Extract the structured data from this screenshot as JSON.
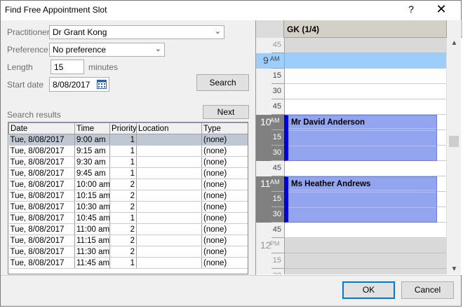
{
  "window": {
    "title": "Find Free Appointment Slot",
    "help": "?",
    "close": "✕"
  },
  "form": {
    "practitioner_label": "Practitioner",
    "practitioner_value": "Dr Grant Kong",
    "preference_label": "Preference",
    "preference_value": "No preference",
    "length_label": "Length",
    "length_value": "15",
    "length_unit": "minutes",
    "startdate_label": "Start date",
    "startdate_value": "8/08/2017",
    "search_button": "Search",
    "results_label": "Search results",
    "next_button": "Next"
  },
  "results": {
    "columns": [
      "Date",
      "Time",
      "Priority",
      "Location",
      "Type"
    ],
    "rows": [
      [
        "Tue, 8/08/2017",
        "9:00 am",
        "1",
        "",
        "(none)"
      ],
      [
        "Tue, 8/08/2017",
        "9:15 am",
        "1",
        "",
        "(none)"
      ],
      [
        "Tue, 8/08/2017",
        "9:30 am",
        "1",
        "",
        "(none)"
      ],
      [
        "Tue, 8/08/2017",
        "9:45 am",
        "1",
        "",
        "(none)"
      ],
      [
        "Tue, 8/08/2017",
        "10:00 am",
        "2",
        "",
        "(none)"
      ],
      [
        "Tue, 8/08/2017",
        "10:15 am",
        "2",
        "",
        "(none)"
      ],
      [
        "Tue, 8/08/2017",
        "10:30 am",
        "2",
        "",
        "(none)"
      ],
      [
        "Tue, 8/08/2017",
        "10:45 am",
        "1",
        "",
        "(none)"
      ],
      [
        "Tue, 8/08/2017",
        "11:00 am",
        "2",
        "",
        "(none)"
      ],
      [
        "Tue, 8/08/2017",
        "11:15 am",
        "2",
        "",
        "(none)"
      ],
      [
        "Tue, 8/08/2017",
        "11:30 am",
        "2",
        "",
        "(none)"
      ],
      [
        "Tue, 8/08/2017",
        "11:45 am",
        "1",
        "",
        "(none)"
      ]
    ]
  },
  "calendar": {
    "column_title": "GK (1/4)",
    "hours": {
      "h9": "9",
      "h10": "10",
      "h11": "11",
      "h12": "12",
      "am": "AM",
      "pm": "PM"
    },
    "minutes": {
      "m15": "15",
      "m30": "30",
      "m45": "45"
    },
    "appointments": [
      {
        "name": "Mr David Anderson"
      },
      {
        "name": "Ms Heather Andrews"
      }
    ]
  },
  "footer": {
    "ok": "OK",
    "cancel": "Cancel"
  }
}
